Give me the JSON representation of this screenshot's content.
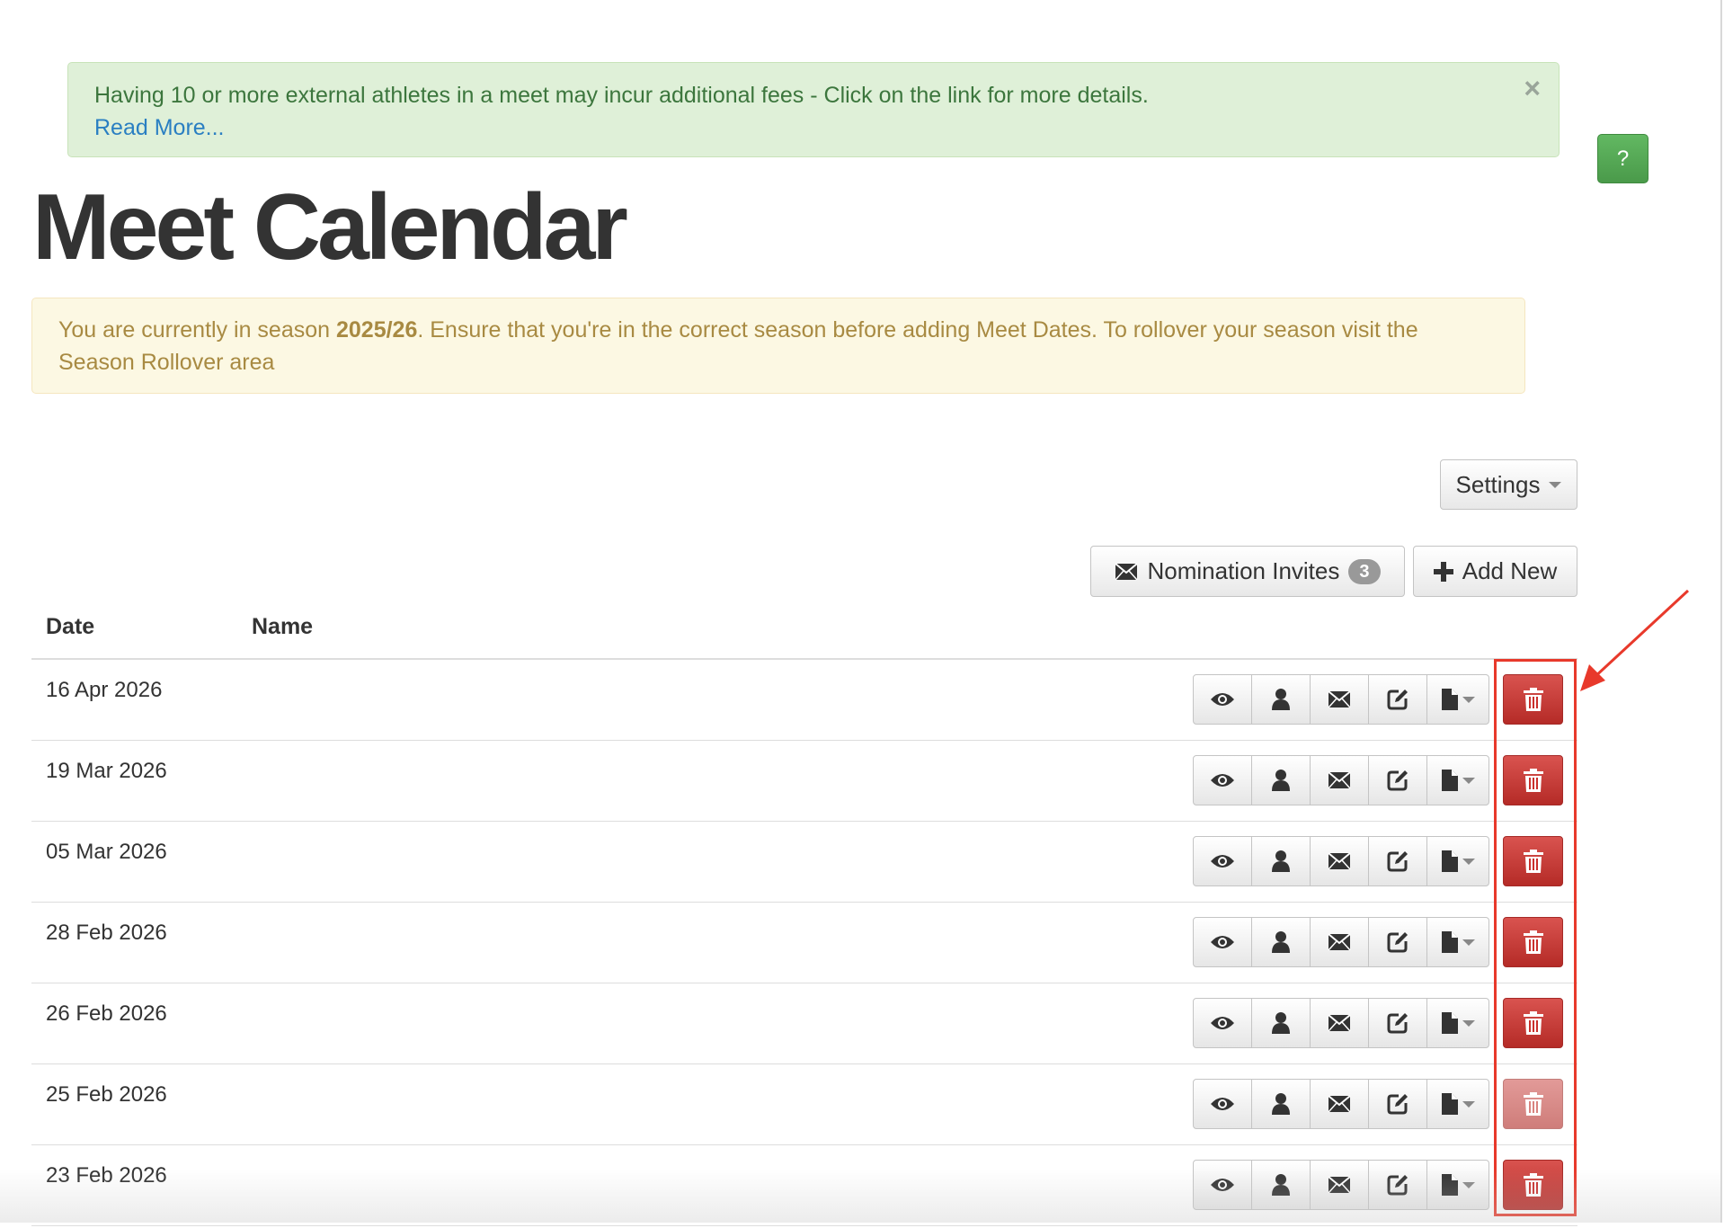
{
  "alerts": {
    "info_text": "Having 10 or more external athletes in a meet may incur additional fees - Click on the link for more details.",
    "read_more": "Read More...",
    "close_symbol": "×",
    "warning_prefix": "You are currently in season ",
    "warning_season": "2025/26",
    "warning_suffix": ". Ensure that you're in the correct season before adding Meet Dates. To rollover your season visit the Season Rollover area"
  },
  "help_button": "?",
  "page_title": "Meet Calendar",
  "toolbar": {
    "settings_label": "Settings",
    "nomination_label": "Nomination Invites",
    "nomination_count": "3",
    "add_new_label": "Add New"
  },
  "table": {
    "headers": [
      "Date",
      "Name"
    ],
    "rows": [
      {
        "date": "16 Apr 2026",
        "name": "",
        "delete_enabled": true
      },
      {
        "date": "19 Mar 2026",
        "name": "",
        "delete_enabled": true
      },
      {
        "date": "05 Mar 2026",
        "name": "",
        "delete_enabled": true
      },
      {
        "date": "28 Feb 2026",
        "name": "",
        "delete_enabled": true
      },
      {
        "date": "26 Feb 2026",
        "name": "",
        "delete_enabled": true
      },
      {
        "date": "25 Feb 2026",
        "name": "",
        "delete_enabled": false
      },
      {
        "date": "23 Feb 2026",
        "name": "",
        "delete_enabled": true
      }
    ],
    "row_actions": [
      "eye-icon",
      "user-icon",
      "envelope-icon",
      "edit-icon",
      "file-icon",
      "trash-icon"
    ]
  },
  "colors": {
    "success_bg": "#dff0d8",
    "success_text": "#3c763d",
    "warning_bg": "#fcf8e3",
    "warning_text": "#a88a42",
    "danger": "#c9302c",
    "help_green": "#4a9a4a",
    "annotation_red": "#e8392b",
    "link": "#2a7fc2"
  }
}
